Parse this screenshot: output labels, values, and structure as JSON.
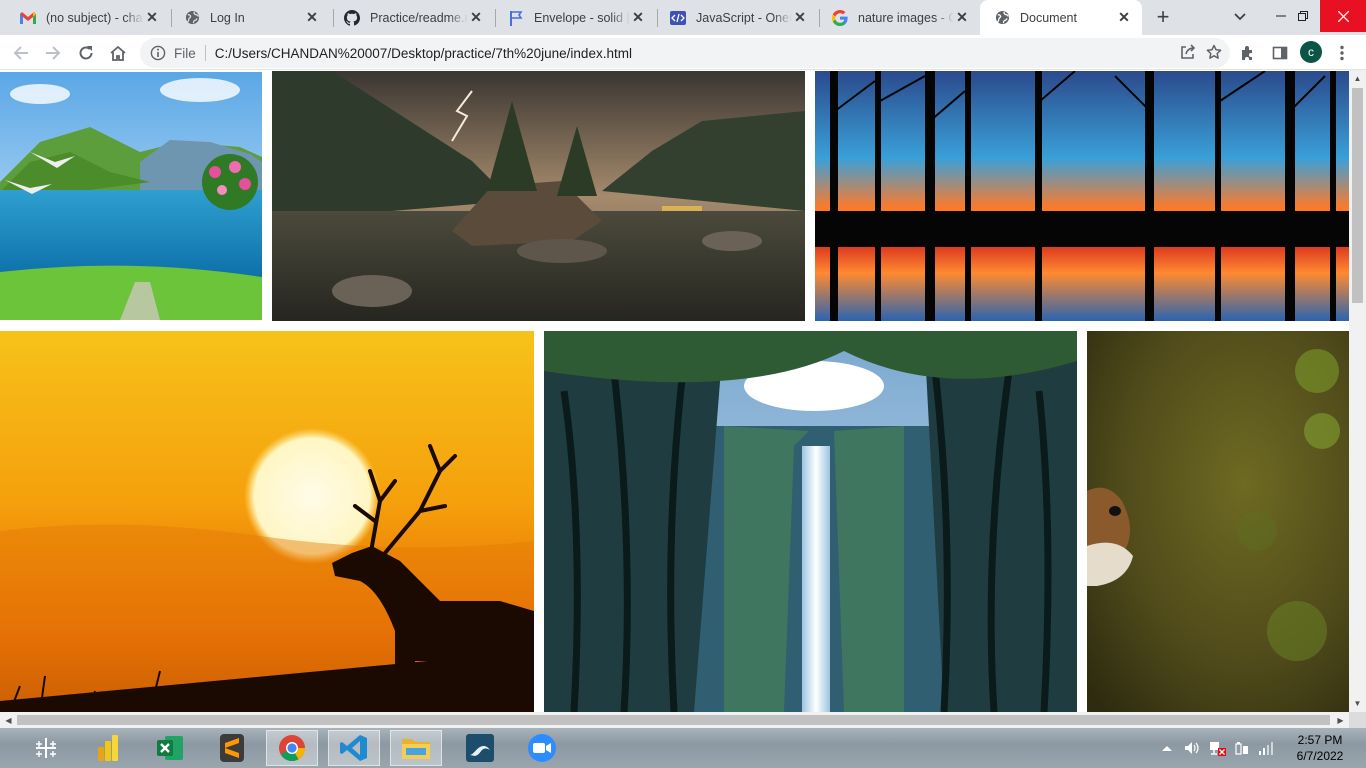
{
  "browser": {
    "tabs": [
      {
        "title": "(no subject) - chan",
        "icon": "gmail-icon",
        "active": false
      },
      {
        "title": "Log In",
        "icon": "globe-icon",
        "active": false
      },
      {
        "title": "Practice/readme.m",
        "icon": "github-icon",
        "active": false
      },
      {
        "title": "Envelope - solid | F",
        "icon": "flag-icon",
        "active": false
      },
      {
        "title": "JavaScript - OneCo",
        "icon": "code-icon",
        "active": false
      },
      {
        "title": "nature images - G",
        "icon": "google-icon",
        "active": false
      },
      {
        "title": "Document",
        "icon": "globe-icon",
        "active": true
      }
    ],
    "new_tab_label": "+",
    "address": {
      "chip": "File",
      "url": "C:/Users/CHANDAN%20007/Desktop/practice/7th%20june/index.html"
    },
    "profile_initial": "c"
  },
  "page": {
    "images": [
      {
        "name": "lake-valley-with-birds"
      },
      {
        "name": "mountain-lake-with-lightning"
      },
      {
        "name": "sunset-forest-silhouette"
      },
      {
        "name": "deer-at-sunset"
      },
      {
        "name": "forest-waterfall"
      },
      {
        "name": "squirrel-peeking"
      }
    ]
  },
  "taskbar": {
    "apps": [
      {
        "name": "tableau-icon",
        "running": false
      },
      {
        "name": "power-bi-icon",
        "running": false
      },
      {
        "name": "excel-icon",
        "running": false
      },
      {
        "name": "sublime-text-icon",
        "running": false
      },
      {
        "name": "chrome-icon",
        "running": true
      },
      {
        "name": "vscode-icon",
        "running": true
      },
      {
        "name": "file-explorer-icon",
        "running": true
      },
      {
        "name": "mysql-workbench-icon",
        "running": false
      },
      {
        "name": "zoom-icon",
        "running": false
      }
    ],
    "clock": {
      "time": "2:57 PM",
      "date": "6/7/2022"
    }
  },
  "colors": {
    "tabstrip": "#dee1e6",
    "profile": "#0b5547",
    "close_hover": "#e81123"
  }
}
